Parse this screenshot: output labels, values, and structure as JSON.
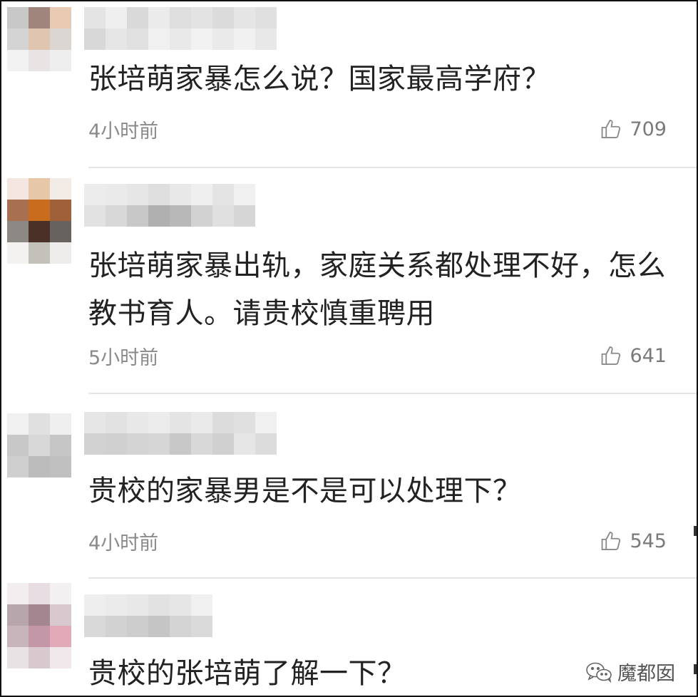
{
  "comments": [
    {
      "text": "张培萌家暴怎么说？国家最高学府？",
      "time": "4小时前",
      "likes": "709",
      "avatar_colors": [
        "#c8c8c8",
        "#a0857c",
        "#e8cbb2",
        "#d4d4d4",
        "#e0c6b0",
        "#dcd6d2",
        "#f2f2f2",
        "#e8e4e4",
        "#efeeee"
      ],
      "name_colors": [
        "#e4e4e4",
        "#d8d8d8",
        "#efefef",
        "#e6e6e6",
        "#d9d9d9",
        "#e1e1e1",
        "#ebebeb",
        "#f0f0f0",
        "#dedede",
        "#e9e9e9",
        "#e3e3e3",
        "#f2f2f2",
        "#dbdbdb",
        "#eaeaea",
        "#e5e5e5",
        "#f1f1f1",
        "#e0e0e0",
        "#e8e8e8"
      ]
    },
    {
      "text": "张培萌家暴出轨，家庭关系都处理不好，怎么教书育人。请贵校慎重聘用",
      "time": "5小时前",
      "likes": "641",
      "avatar_colors": [
        "#f4e7e1",
        "#e6c8a9",
        "#f3ebe5",
        "#a87050",
        "#c86c1e",
        "#a0603a",
        "#8c8884",
        "#4a3026",
        "#68625e",
        "#f3f2f1",
        "#c4c0ba",
        "#eeedec"
      ],
      "name_colors": [
        "#ececec",
        "#e2e2e2",
        "#eaeaea",
        "#d8d8d8",
        "#e6e6e6",
        "#c8c8c8",
        "#dedede",
        "#b0b0b0",
        "#e8e8e8",
        "#b8b8b8",
        "#efefef",
        "#d2d2d2",
        "#e4e4e4",
        "#e0e0e0",
        "#f0f0f0",
        "#d6d6d6"
      ]
    },
    {
      "text": "贵校的家暴男是不是可以处理下？",
      "time": "4小时前",
      "likes": "545",
      "avatar_colors": [
        "#f0f0f0",
        "#e0e0e0",
        "#efefef",
        "#c8c8c8",
        "#d8d8d8",
        "#c6c6c6",
        "#cfcfcf",
        "#bcbcbc",
        "#c0c0c0"
      ],
      "name_colors": [
        "#e6e6e6",
        "#d2d2d2",
        "#e2e2e2",
        "#d0d0d0",
        "#e8e8e8",
        "#d4d4d4",
        "#ececec",
        "#d6d6d6",
        "#e4e4e4",
        "#c8c8c8",
        "#eaeaea",
        "#d8d8d8",
        "#dcdcdc",
        "#d0d0d0",
        "#e0e0e0",
        "#e6e6e6",
        "#f0f0f0",
        "#dcdcdc"
      ]
    },
    {
      "text": "贵校的张培萌了解一下？",
      "time": "",
      "likes": "",
      "avatar_colors": [
        "#f2eeef",
        "#e8dde2",
        "#f3f0f1",
        "#b7a7ad",
        "#a3868f",
        "#d7c9cd",
        "#c8b5bc",
        "#c497a8",
        "#e2a9b9",
        "#e8e2e4",
        "#d9c9cf",
        "#f1e8eb"
      ],
      "name_colors": [
        "#eeeeee",
        "#d9d9d9",
        "#ebebeb",
        "#d2d2d2",
        "#e8e8e8",
        "#cdcdcd",
        "#e2e2e2",
        "#c5c5c5",
        "#e6e6e6",
        "#d4d4d4",
        "#f0f0f0",
        "#dadada"
      ]
    }
  ],
  "watermark": {
    "label": "魔都囡"
  }
}
